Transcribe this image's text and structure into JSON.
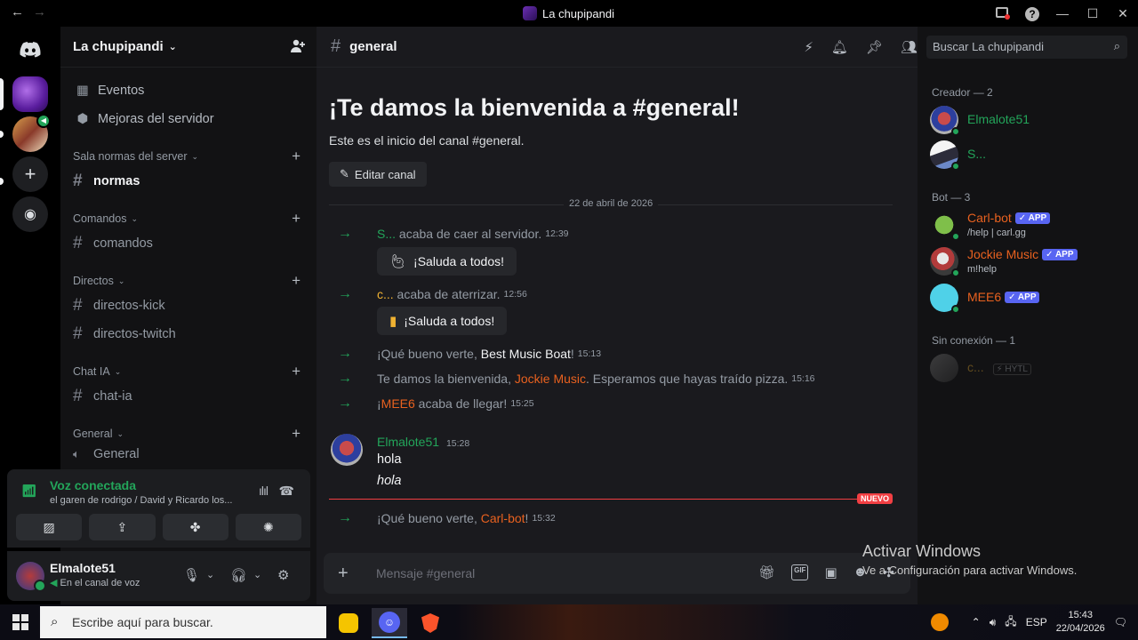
{
  "window": {
    "title": "La chupipandi"
  },
  "sidebar": {
    "server_name": "La chupipandi",
    "top_links": [
      {
        "label": "Eventos"
      },
      {
        "label": "Mejoras del servidor"
      }
    ],
    "categories": [
      {
        "name": "Sala normas del server",
        "channels": [
          "normas"
        ]
      },
      {
        "name": "Comandos",
        "channels": [
          "comandos"
        ]
      },
      {
        "name": "Directos",
        "channels": [
          "directos-kick",
          "directos-twitch"
        ]
      },
      {
        "name": "Chat IA",
        "channels": [
          "chat-ia"
        ]
      },
      {
        "name": "General",
        "channels": [
          "General"
        ]
      }
    ]
  },
  "voice": {
    "status": "Voz conectada",
    "location": "el garen de rodrigo / David y Ricardo los..."
  },
  "user": {
    "name": "Elmalote51",
    "status": "En el canal de voz"
  },
  "chat": {
    "channel": "general",
    "welcome_title": "¡Te damos la bienvenida a #general!",
    "welcome_sub": "Este es el inicio del canal #general.",
    "edit_label": "Editar canal",
    "date": "22 de abril de 2026",
    "wave_label": "¡Saluda a todos!",
    "events": [
      {
        "user": "S...",
        "text": " acaba de caer al servidor.",
        "time": "12:39"
      },
      {
        "user": "c...",
        "text": " acaba de aterrizar.",
        "time": "12:56"
      },
      {
        "pre": "¡Qué bueno verte, ",
        "user": "Best Music Boat",
        "post": "!",
        "time": "15:13"
      },
      {
        "pre": "Te damos la bienvenida, ",
        "user": "Jockie Music",
        "post": ". Esperamos que hayas traído pizza.",
        "time": "15:16"
      },
      {
        "pre": "¡",
        "user": "MEE6",
        "post": " acaba de llegar!",
        "time": "15:25"
      },
      {
        "pre": "¡Qué bueno verte, ",
        "user": "Carl-bot",
        "post": "!",
        "time": "15:32"
      }
    ],
    "message": {
      "author": "Elmalote51",
      "time": "15:28",
      "lines": [
        "hola",
        "hola"
      ]
    },
    "new_label": "NUEVO",
    "composer_placeholder": "Mensaje #general"
  },
  "members": {
    "search_placeholder": "Buscar La chupipandi",
    "groups": [
      {
        "title": "Creador — 2"
      },
      {
        "title": "Bot — 3"
      },
      {
        "title": "Sin conexión — 1"
      }
    ],
    "creators": [
      "Elmalote51",
      "S..."
    ],
    "bots": [
      {
        "name": "Carl-bot",
        "sub": "/help | carl.gg"
      },
      {
        "name": "Jockie Music",
        "sub": "m!help"
      },
      {
        "name": "MEE6",
        "sub": ""
      }
    ],
    "offline": {
      "name": "c...",
      "tag": "HYTL"
    },
    "app_badge": "APP"
  },
  "watermark": {
    "line1": "Activar Windows",
    "line2": "Ve a Configuración para activar Windows."
  },
  "taskbar": {
    "search_placeholder": "Escribe aquí para buscar.",
    "lang": "ESP",
    "time": "15:43",
    "date": "22/04/2026"
  },
  "colors": {
    "accent_green": "#23a55a",
    "bot_orange": "#e8611f",
    "app_badge": "#5865f2",
    "new_red": "#f23f43"
  }
}
